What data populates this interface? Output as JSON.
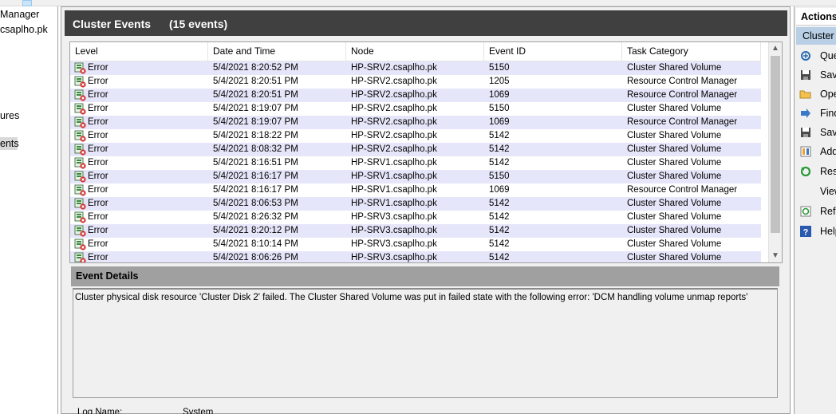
{
  "tree": {
    "items": [
      {
        "label": "Manager",
        "selected": false
      },
      {
        "label": "csaplho.pk",
        "selected": false
      },
      {
        "label": "ures",
        "selected": false
      },
      {
        "label": "ents",
        "selected": true
      }
    ]
  },
  "panel": {
    "title": "Cluster Events",
    "count": "(15 events)"
  },
  "grid": {
    "columns": [
      "Level",
      "Date and Time",
      "Node",
      "Event ID",
      "Task Category"
    ],
    "rows": [
      {
        "level": "Error",
        "date": "5/4/2021 8:20:52 PM",
        "node": "HP-SRV2.csaplho.pk",
        "event_id": "5150",
        "category": "Cluster Shared Volume"
      },
      {
        "level": "Error",
        "date": "5/4/2021 8:20:51 PM",
        "node": "HP-SRV2.csaplho.pk",
        "event_id": "1205",
        "category": "Resource Control Manager"
      },
      {
        "level": "Error",
        "date": "5/4/2021 8:20:51 PM",
        "node": "HP-SRV2.csaplho.pk",
        "event_id": "1069",
        "category": "Resource Control Manager"
      },
      {
        "level": "Error",
        "date": "5/4/2021 8:19:07 PM",
        "node": "HP-SRV2.csaplho.pk",
        "event_id": "5150",
        "category": "Cluster Shared Volume"
      },
      {
        "level": "Error",
        "date": "5/4/2021 8:19:07 PM",
        "node": "HP-SRV2.csaplho.pk",
        "event_id": "1069",
        "category": "Resource Control Manager"
      },
      {
        "level": "Error",
        "date": "5/4/2021 8:18:22 PM",
        "node": "HP-SRV2.csaplho.pk",
        "event_id": "5142",
        "category": "Cluster Shared Volume"
      },
      {
        "level": "Error",
        "date": "5/4/2021 8:08:32 PM",
        "node": "HP-SRV2.csaplho.pk",
        "event_id": "5142",
        "category": "Cluster Shared Volume"
      },
      {
        "level": "Error",
        "date": "5/4/2021 8:16:51 PM",
        "node": "HP-SRV1.csaplho.pk",
        "event_id": "5142",
        "category": "Cluster Shared Volume"
      },
      {
        "level": "Error",
        "date": "5/4/2021 8:16:17 PM",
        "node": "HP-SRV1.csaplho.pk",
        "event_id": "5150",
        "category": "Cluster Shared Volume"
      },
      {
        "level": "Error",
        "date": "5/4/2021 8:16:17 PM",
        "node": "HP-SRV1.csaplho.pk",
        "event_id": "1069",
        "category": "Resource Control Manager"
      },
      {
        "level": "Error",
        "date": "5/4/2021 8:06:53 PM",
        "node": "HP-SRV1.csaplho.pk",
        "event_id": "5142",
        "category": "Cluster Shared Volume"
      },
      {
        "level": "Error",
        "date": "5/4/2021 8:26:32 PM",
        "node": "HP-SRV3.csaplho.pk",
        "event_id": "5142",
        "category": "Cluster Shared Volume"
      },
      {
        "level": "Error",
        "date": "5/4/2021 8:20:12 PM",
        "node": "HP-SRV3.csaplho.pk",
        "event_id": "5142",
        "category": "Cluster Shared Volume"
      },
      {
        "level": "Error",
        "date": "5/4/2021 8:10:14 PM",
        "node": "HP-SRV3.csaplho.pk",
        "event_id": "5142",
        "category": "Cluster Shared Volume"
      },
      {
        "level": "Error",
        "date": "5/4/2021 8:06:26 PM",
        "node": "HP-SRV3.csaplho.pk",
        "event_id": "5142",
        "category": "Cluster Shared Volume"
      }
    ]
  },
  "details": {
    "title": "Event Details",
    "text": "Cluster physical disk resource 'Cluster Disk 2' failed.  The Cluster Shared Volume was put in failed state with the following error: 'DCM handling volume unmap reports'",
    "log_name_label": "Log Name:",
    "log_name_value": "System"
  },
  "actions": {
    "title": "Actions",
    "subtitle": "Cluster E",
    "items": [
      {
        "label": "Que",
        "icon": "query-icon"
      },
      {
        "label": "Save",
        "icon": "save-icon"
      },
      {
        "label": "Ope",
        "icon": "open-folder-icon"
      },
      {
        "label": "Find",
        "icon": "find-icon"
      },
      {
        "label": "Save",
        "icon": "save-icon"
      },
      {
        "label": "Add",
        "icon": "add-icon"
      },
      {
        "label": "Rese",
        "icon": "reset-icon"
      },
      {
        "label": "View",
        "icon": "none"
      },
      {
        "label": "Refr",
        "icon": "refresh-icon"
      },
      {
        "label": "Help",
        "icon": "help-icon"
      }
    ]
  },
  "colors": {
    "header_bg": "#404040",
    "row_alt": "#e6e6fa",
    "error_red": "#d32f2f",
    "details_bar": "#a0a0a0",
    "actions_sub": "#b8cfe6"
  }
}
